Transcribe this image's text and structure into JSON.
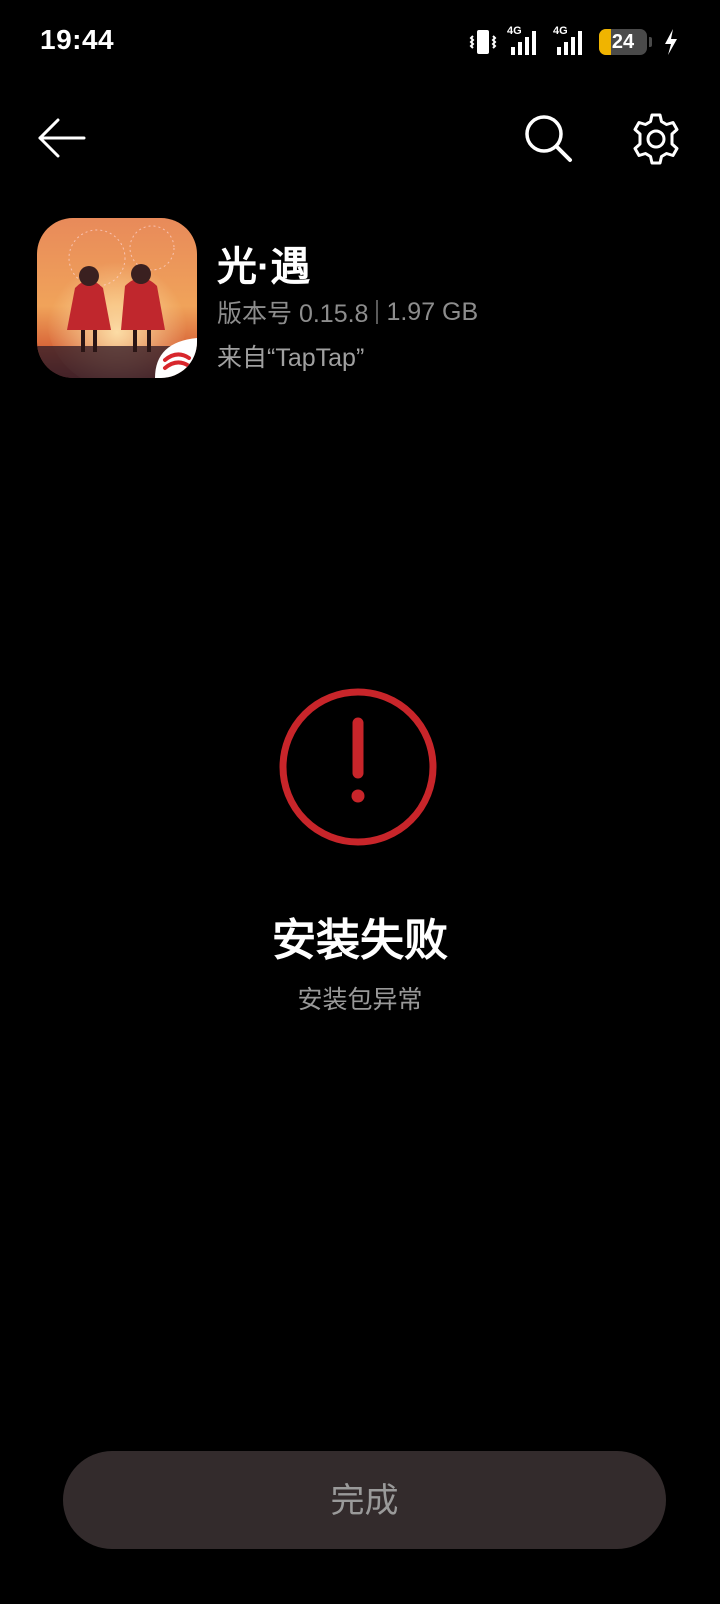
{
  "status_bar": {
    "time": "19:44",
    "signal1_label": "4G",
    "signal2_label": "4G",
    "battery_level": "24",
    "battery_fraction": 0.24,
    "battery_color": "#f0b400",
    "icons": [
      "vibrate-icon",
      "signal-4g-icon",
      "signal-4g-icon",
      "battery-icon",
      "charging-icon"
    ]
  },
  "nav": {
    "back_icon": "back-arrow-icon",
    "search_icon": "search-icon",
    "settings_icon": "gear-icon"
  },
  "app": {
    "name": "光·遇",
    "version_label": "版本号 0.15.8",
    "size": "1.97 GB",
    "source": "来自“TapTap”"
  },
  "result": {
    "icon": "error-exclamation-icon",
    "icon_color": "#c8252a",
    "title": "安装失败",
    "description": "安装包异常"
  },
  "actions": {
    "done_label": "完成"
  }
}
